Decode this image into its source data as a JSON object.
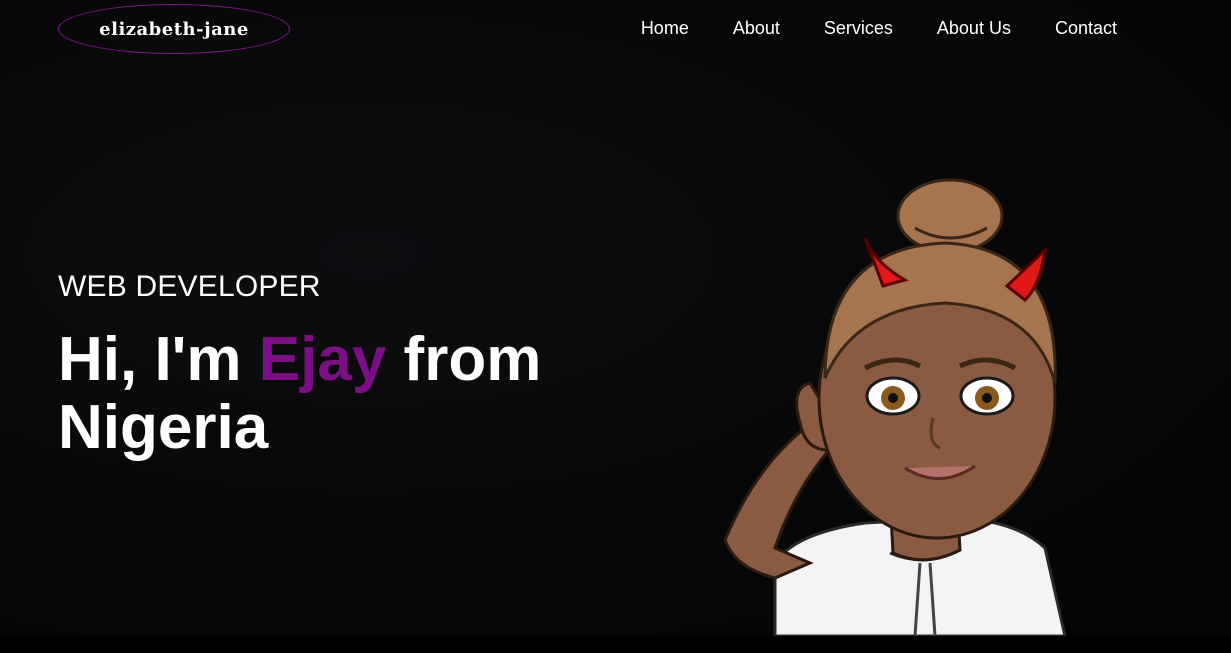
{
  "logo": {
    "text": "elizabeth-jane"
  },
  "nav": {
    "items": [
      {
        "label": "Home"
      },
      {
        "label": "About"
      },
      {
        "label": "Services"
      },
      {
        "label": "About Us"
      },
      {
        "label": "Contact"
      }
    ]
  },
  "hero": {
    "subtitle": "WEB DEVELOPER",
    "greeting": "Hi, I'm ",
    "name": "Ejay",
    "suffix": " from Nigeria"
  },
  "colors": {
    "background": "#070608",
    "accent": "#7d0f86",
    "text": "#ffffff",
    "logo_border": "#7b1a86"
  },
  "icons": {
    "avatar": "cartoon-devil-girl-avatar-icon"
  }
}
